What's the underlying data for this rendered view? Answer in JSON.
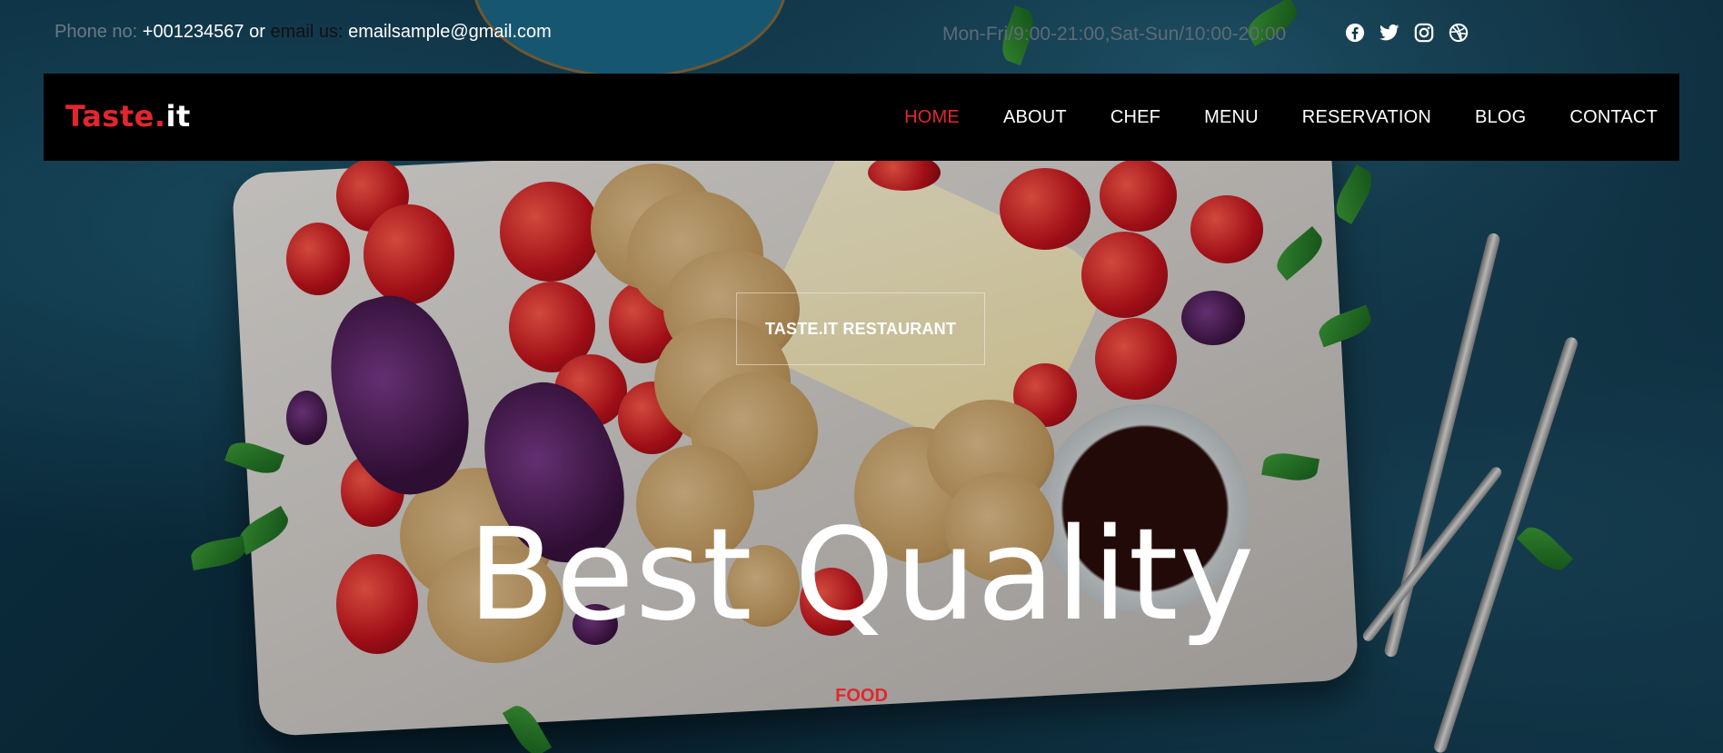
{
  "topbar": {
    "phone_label": "Phone no:",
    "phone_value": "+001234567",
    "or_text": "or",
    "email_label": "email us:",
    "email_value": "emailsample@gmail.com",
    "hours": "Mon-Fri/9:00-21:00,Sat-Sun/10:00-20:00",
    "social_icons": [
      "facebook-icon",
      "twitter-icon",
      "instagram-icon",
      "dribbble-icon"
    ]
  },
  "nav": {
    "brand_part1": "Taste.",
    "brand_part2": "it",
    "items": [
      {
        "label": "HOME",
        "active": true
      },
      {
        "label": "ABOUT",
        "active": false
      },
      {
        "label": "CHEF",
        "active": false
      },
      {
        "label": "MENU",
        "active": false
      },
      {
        "label": "RESERVATION",
        "active": false
      },
      {
        "label": "BLOG",
        "active": false
      },
      {
        "label": "CONTACT",
        "active": false
      }
    ]
  },
  "hero": {
    "subtitle": "TASTE.IT RESTAURANT",
    "headline": "Best Quality",
    "tag": "FOOD"
  },
  "colors": {
    "accent": "#e3262e",
    "nav_bg": "#000000",
    "text": "#ffffff"
  }
}
